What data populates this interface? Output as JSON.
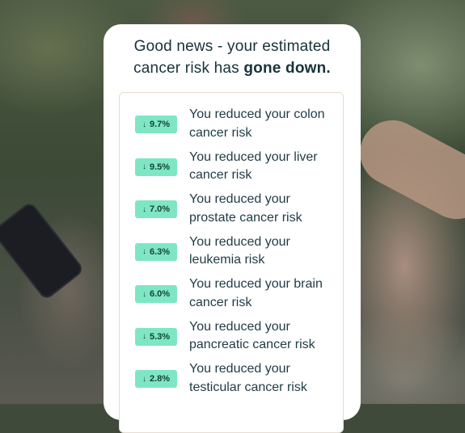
{
  "headline": {
    "line1": "Good news - your estimated",
    "line2_prefix": "cancer risk has ",
    "line2_bold": "gone down."
  },
  "risk_items": [
    {
      "percent": "9.7%",
      "line1": "You reduced your colon",
      "line2": "cancer risk"
    },
    {
      "percent": "9.5%",
      "line1": "You reduced your liver",
      "line2": "cancer risk"
    },
    {
      "percent": "7.0%",
      "line1": "You reduced your",
      "line2": "prostate cancer risk"
    },
    {
      "percent": "6.3%",
      "line1": "You reduced your",
      "line2": "leukemia risk"
    },
    {
      "percent": "6.0%",
      "line1": "You reduced your brain",
      "line2": "cancer risk"
    },
    {
      "percent": "5.3%",
      "line1": "You reduced your",
      "line2": "pancreatic cancer risk"
    },
    {
      "percent": "2.8%",
      "line1": "You reduced your",
      "line2": "testicular cancer risk"
    }
  ],
  "icons": {
    "badge_arrow": "arrow-down-icon"
  },
  "colors": {
    "badge_bg": "#7fe6c4",
    "text": "#1f3b45",
    "panel_border": "#e8dccd"
  }
}
